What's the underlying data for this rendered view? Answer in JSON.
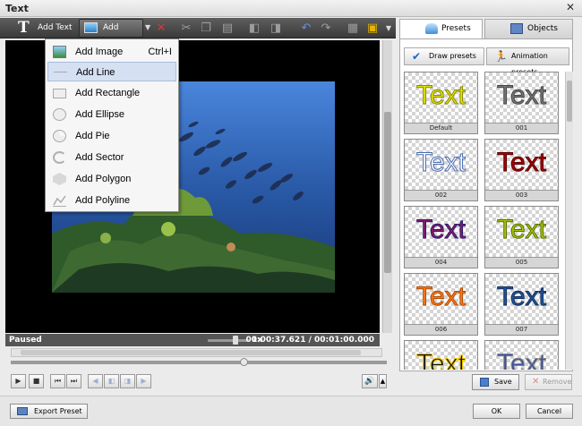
{
  "window": {
    "title": "Text",
    "close_glyph": "✕"
  },
  "toolbar": {
    "add_text_label": "Add Text",
    "add_image_label": "Add Image",
    "icons": [
      "delete-icon",
      "cut-icon",
      "copy-icon",
      "paste-icon",
      "bring-forward-icon",
      "send-backward-icon",
      "undo-icon",
      "redo-icon",
      "grid-icon",
      "frame-icon"
    ]
  },
  "menu": {
    "items": [
      {
        "label": "Add Image",
        "shortcut": "Ctrl+I"
      },
      {
        "label": "Add Line",
        "shortcut": ""
      },
      {
        "label": "Add Rectangle",
        "shortcut": ""
      },
      {
        "label": "Add Ellipse",
        "shortcut": ""
      },
      {
        "label": "Add Pie",
        "shortcut": ""
      },
      {
        "label": "Add Sector",
        "shortcut": ""
      },
      {
        "label": "Add Polygon",
        "shortcut": ""
      },
      {
        "label": "Add Polyline",
        "shortcut": ""
      }
    ],
    "highlighted": "Add Line"
  },
  "status": {
    "state": "Paused",
    "speed": "1x",
    "time": "00:00:37.621 / 00:01:00.000",
    "timeline_progress": 0.62
  },
  "tabs": {
    "presets": "Presets",
    "objects": "Objects"
  },
  "subtabs": {
    "draw": "Draw presets",
    "animation": "Animation presets"
  },
  "presets": [
    {
      "caption": "Default",
      "text": "Text",
      "color": "#e4e400",
      "stroke": "#8a8a00"
    },
    {
      "caption": "001",
      "text": "Text",
      "color": "#777777",
      "stroke": "#444444"
    },
    {
      "caption": "002",
      "text": "Text",
      "color": "#ffffff",
      "stroke": "#4a6bb0"
    },
    {
      "caption": "003",
      "text": "Text",
      "color": "#a50000",
      "stroke": "#600000"
    },
    {
      "caption": "004",
      "text": "Text",
      "color": "#8a1a6a",
      "stroke": "#30186a"
    },
    {
      "caption": "005",
      "text": "Text",
      "color": "#a6c800",
      "stroke": "#5a7000"
    },
    {
      "caption": "006",
      "text": "Text",
      "color": "#ff7a1a",
      "stroke": "#b04a00"
    },
    {
      "caption": "007",
      "text": "Text",
      "color": "#22559a",
      "stroke": "#0f2f60"
    },
    {
      "caption": "",
      "text": "Text",
      "color": "#111111",
      "stroke": "#f2c500"
    },
    {
      "caption": "",
      "text": "Text",
      "color": "#3a4fa0",
      "stroke": "#8a8a8a"
    }
  ],
  "buttons": {
    "save": "Save",
    "remove": "Remove",
    "export": "Export Preset",
    "ok": "OK",
    "cancel": "Cancel"
  },
  "colors": {
    "toolbar": "#4a4a4a",
    "accent": "#1f63c4"
  }
}
